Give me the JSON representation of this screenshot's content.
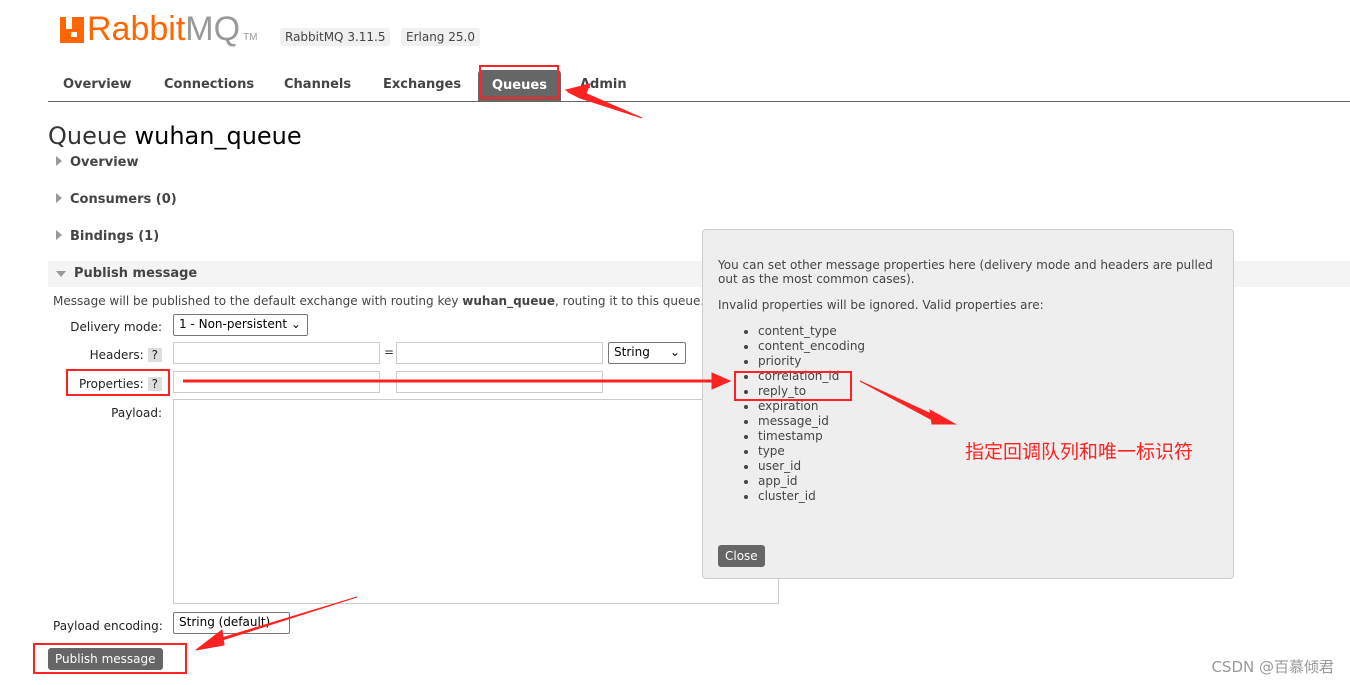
{
  "header": {
    "logo_text": "RabbitMQ",
    "logo_tm": "TM",
    "version": "RabbitMQ 3.11.5",
    "erlang": "Erlang 25.0"
  },
  "nav": [
    "Overview",
    "Connections",
    "Channels",
    "Exchanges",
    "Queues",
    "Admin"
  ],
  "nav_active": "Queues",
  "page": {
    "title_prefix": "Queue",
    "queue_name": "wuhan_queue"
  },
  "sections": [
    "Overview",
    "Consumers (0)",
    "Bindings (1)",
    "Publish message"
  ],
  "publish": {
    "info_prefix": "Message will be published to the default exchange with routing key ",
    "info_key": "wuhan_queue",
    "info_suffix": ", routing it to this queue.",
    "delivery_label": "Delivery mode:",
    "delivery_value": "1 - Non-persistent",
    "headers_label": "Headers:",
    "help": "?",
    "equals": "=",
    "type_value": "String",
    "properties_label": "Properties:",
    "payload_label": "Payload:",
    "encoding_label": "Payload encoding:",
    "encoding_value": "String (default)",
    "button": "Publish message"
  },
  "popup": {
    "text1": "You can set other message properties here (delivery mode and headers are pulled out as the most common cases).",
    "text2": "Invalid properties will be ignored. Valid properties are:",
    "properties": [
      "content_type",
      "content_encoding",
      "priority",
      "correlation_id",
      "reply_to",
      "expiration",
      "message_id",
      "timestamp",
      "type",
      "user_id",
      "app_id",
      "cluster_id"
    ],
    "close": "Close"
  },
  "annotation": {
    "note": "指定回调队列和唯一标识符",
    "color": "#ff2222"
  },
  "watermark": "CSDN @百慕倾君"
}
